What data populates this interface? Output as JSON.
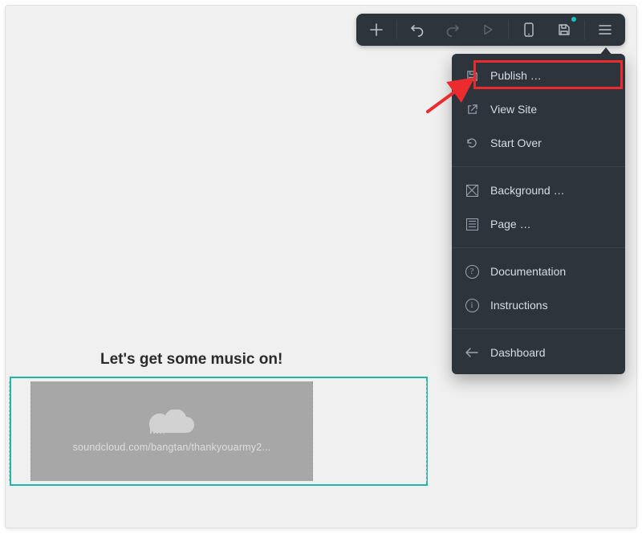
{
  "toolbar": {
    "add_icon": "add",
    "undo_icon": "undo",
    "redo_icon": "redo",
    "play_icon": "play",
    "device_icon": "device",
    "save_icon": "save",
    "menu_icon": "menu"
  },
  "dropdown": {
    "items": [
      {
        "label": "Publish …",
        "icon": "floppy"
      },
      {
        "label": "View Site",
        "icon": "external"
      },
      {
        "label": "Start Over",
        "icon": "refresh"
      }
    ],
    "items2": [
      {
        "label": "Background …",
        "icon": "box-x"
      },
      {
        "label": "Page …",
        "icon": "page-lines"
      }
    ],
    "items3": [
      {
        "label": "Documentation",
        "icon": "question"
      },
      {
        "label": "Instructions",
        "icon": "info"
      }
    ],
    "items4": [
      {
        "label": "Dashboard",
        "icon": "back"
      }
    ]
  },
  "content": {
    "heading": "Let's get some music on!",
    "soundcloud_url": "soundcloud.com/bangtan/thankyouarmy2..."
  },
  "annotation": {
    "highlight_target": "Publish …",
    "arrow_color": "#ec2b2f"
  }
}
